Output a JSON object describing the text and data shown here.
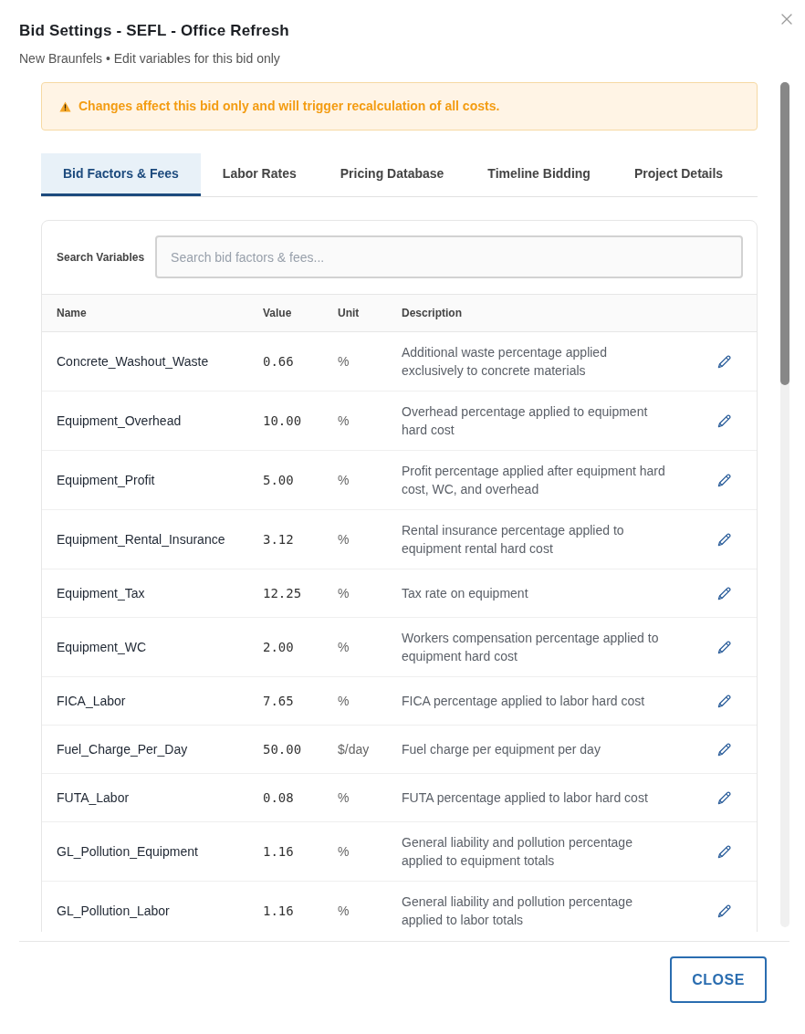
{
  "dialog": {
    "title": "Bid Settings - SEFL - Office Refresh",
    "subtitle": "New Braunfels • Edit variables for this bid only"
  },
  "alert": {
    "text": "Changes affect this bid only and will trigger recalculation of all costs."
  },
  "tabs": [
    {
      "label": "Bid Factors & Fees",
      "selected": true
    },
    {
      "label": "Labor Rates",
      "selected": false
    },
    {
      "label": "Pricing Database",
      "selected": false
    },
    {
      "label": "Timeline Bidding",
      "selected": false
    },
    {
      "label": "Project Details",
      "selected": false
    }
  ],
  "search": {
    "label": "Search Variables",
    "placeholder": "Search bid factors & fees..."
  },
  "table": {
    "columns": [
      "Name",
      "Value",
      "Unit",
      "Description"
    ],
    "rows": [
      {
        "name": "Concrete_Washout_Waste",
        "value": "0.66",
        "unit": "%",
        "description": "Additional waste percentage applied exclusively to concrete materials"
      },
      {
        "name": "Equipment_Overhead",
        "value": "10.00",
        "unit": "%",
        "description": "Overhead percentage applied to equipment hard cost"
      },
      {
        "name": "Equipment_Profit",
        "value": "5.00",
        "unit": "%",
        "description": "Profit percentage applied after equipment hard cost, WC, and overhead"
      },
      {
        "name": "Equipment_Rental_Insurance",
        "value": "3.12",
        "unit": "%",
        "description": "Rental insurance percentage applied to equipment rental hard cost"
      },
      {
        "name": "Equipment_Tax",
        "value": "12.25",
        "unit": "%",
        "description": "Tax rate on equipment"
      },
      {
        "name": "Equipment_WC",
        "value": "2.00",
        "unit": "%",
        "description": "Workers compensation percentage applied to equipment hard cost"
      },
      {
        "name": "FICA_Labor",
        "value": "7.65",
        "unit": "%",
        "description": "FICA percentage applied to labor hard cost"
      },
      {
        "name": "Fuel_Charge_Per_Day",
        "value": "50.00",
        "unit": "$/day",
        "description": "Fuel charge per equipment per day"
      },
      {
        "name": "FUTA_Labor",
        "value": "0.08",
        "unit": "%",
        "description": "FUTA percentage applied to labor hard cost"
      },
      {
        "name": "GL_Pollution_Equipment",
        "value": "1.16",
        "unit": "%",
        "description": "General liability and pollution percentage applied to equipment totals"
      },
      {
        "name": "GL_Pollution_Labor",
        "value": "1.16",
        "unit": "%",
        "description": "General liability and pollution percentage applied to labor totals"
      }
    ]
  },
  "footer": {
    "close_button": "CLOSE"
  }
}
